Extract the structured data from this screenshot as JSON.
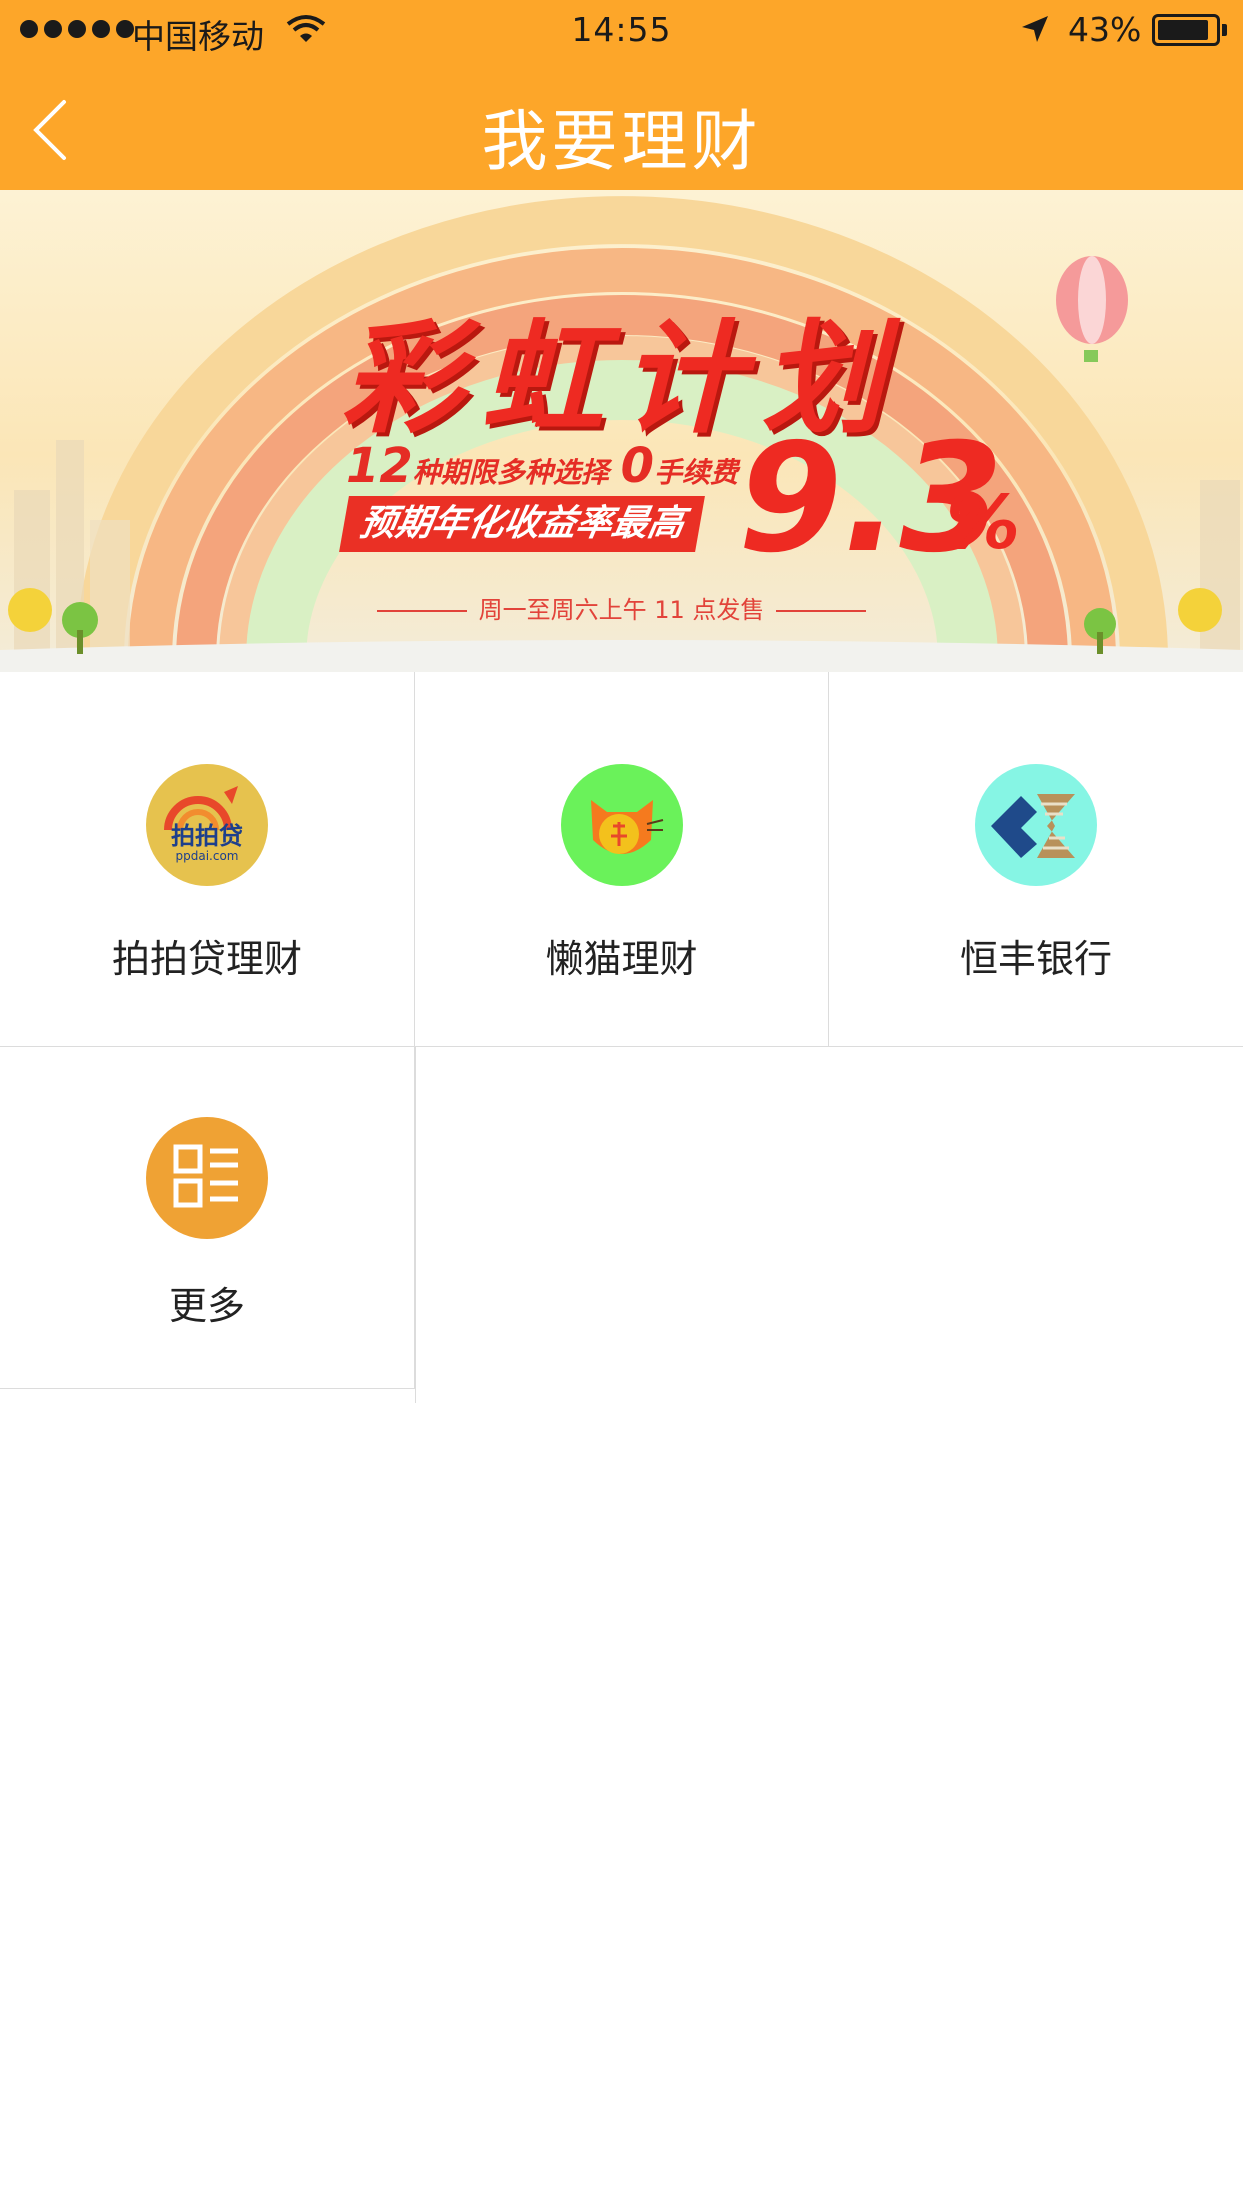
{
  "status_bar": {
    "carrier": "中国移动",
    "time": "14:55",
    "battery": "43%",
    "battery_level": 0.9
  },
  "nav": {
    "title": "我要理财"
  },
  "banner": {
    "title": "彩虹计划",
    "line1_num1": "12",
    "line1_text1": "种期限多种选择",
    "line1_num2": "0",
    "line1_text2": "手续费",
    "tag": "预期年化收益率最高",
    "rate": "9.3",
    "rate_unit": "%",
    "schedule": "周一至周六上午 11 点发售"
  },
  "products": [
    {
      "label": "拍拍贷理财",
      "icon": "ppdai-logo-icon",
      "color": "#e6c24e",
      "logo_text": "拍拍贷",
      "logo_sub": "ppdai.com"
    },
    {
      "label": "懒猫理财",
      "icon": "lazy-cat-icon",
      "color": "#6af25a"
    },
    {
      "label": "恒丰银行",
      "icon": "hengfeng-bank-icon",
      "color": "#86f5e4"
    },
    {
      "label": "更多",
      "icon": "more-grid-icon",
      "color": "#efa234"
    }
  ],
  "colors": {
    "nav_bg": "#fda629",
    "accent_red": "#ee2a22",
    "divider": "#dcdcdc"
  }
}
